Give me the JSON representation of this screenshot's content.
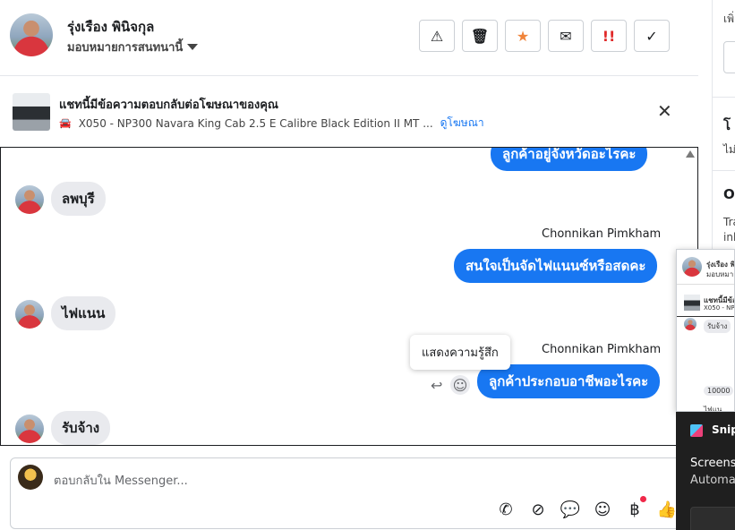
{
  "header": {
    "user_name": "รุ่งเรือง พินิจกุล",
    "assign_label": "มอบหมายการสนทนานี้",
    "toolbar": [
      {
        "name": "spam-button",
        "icon": "warning-icon",
        "glyph": "⚠",
        "color": "#1c1e21"
      },
      {
        "name": "delete-button",
        "icon": "trash-icon",
        "glyph": "🗑",
        "color": "#1c1e21"
      },
      {
        "name": "star-button",
        "icon": "star-icon",
        "glyph": "★",
        "color": "#f0843a"
      },
      {
        "name": "mark-unread-button",
        "icon": "envelope-open-icon",
        "glyph": "✉",
        "color": "#1c1e21"
      },
      {
        "name": "follow-up-button",
        "icon": "follow-up-icon",
        "glyph": "!!",
        "color": "#e02a2a"
      },
      {
        "name": "mark-done-button",
        "icon": "check-icon",
        "glyph": "✓",
        "color": "#1c1e21"
      }
    ]
  },
  "ad": {
    "title": "แชทนี้มีข้อความตอบกลับต่อโฆษณาของคุณ",
    "subtitle": "X050 - NP300 Navara King Cab 2.5 E Calibre Black Edition II MT ...",
    "link": "ดูโฆษณา",
    "close": "✕"
  },
  "conversation": {
    "messages": [
      {
        "dir": "out",
        "text": "ลูกค้าอยู่จังหวัดอะไรคะ"
      },
      {
        "dir": "in",
        "text": "ลพบุรี"
      },
      {
        "dir": "out",
        "sender": "Chonnikan Pimkham",
        "text": "สนใจเป็นจัดไฟแนนซ์หรือสดคะ"
      },
      {
        "dir": "in",
        "text": "ไฟแนน"
      },
      {
        "dir": "out",
        "sender": "Chonnikan Pimkham",
        "text": "ลูกค้าประกอบอาชีพอะไรคะ"
      },
      {
        "dir": "in",
        "text": "รับจ้าง"
      }
    ],
    "tooltip": "แสดงความรู้สึก"
  },
  "reply": {
    "placeholder": "ตอบกลับใน Messenger..."
  },
  "sidebar": {
    "top_text": "เพิ่",
    "section1_title": "โ",
    "section1_sub": "ไม่",
    "section2_title": "O",
    "section2_sub1": "Tra",
    "section2_sub2": "inb"
  },
  "preview": {
    "name": "รุ่งเรือง พิ",
    "assign": "มอบหมายการ",
    "ad_title": "แชทนี้มีข้อค",
    "ad_sub": "X050 - NP",
    "msg1": "รับจ้าง",
    "msg2": "10000",
    "msg3": "ไฟแน"
  },
  "toast": {
    "app": "Snipp",
    "title": "Screensh",
    "sub": "Automat"
  }
}
